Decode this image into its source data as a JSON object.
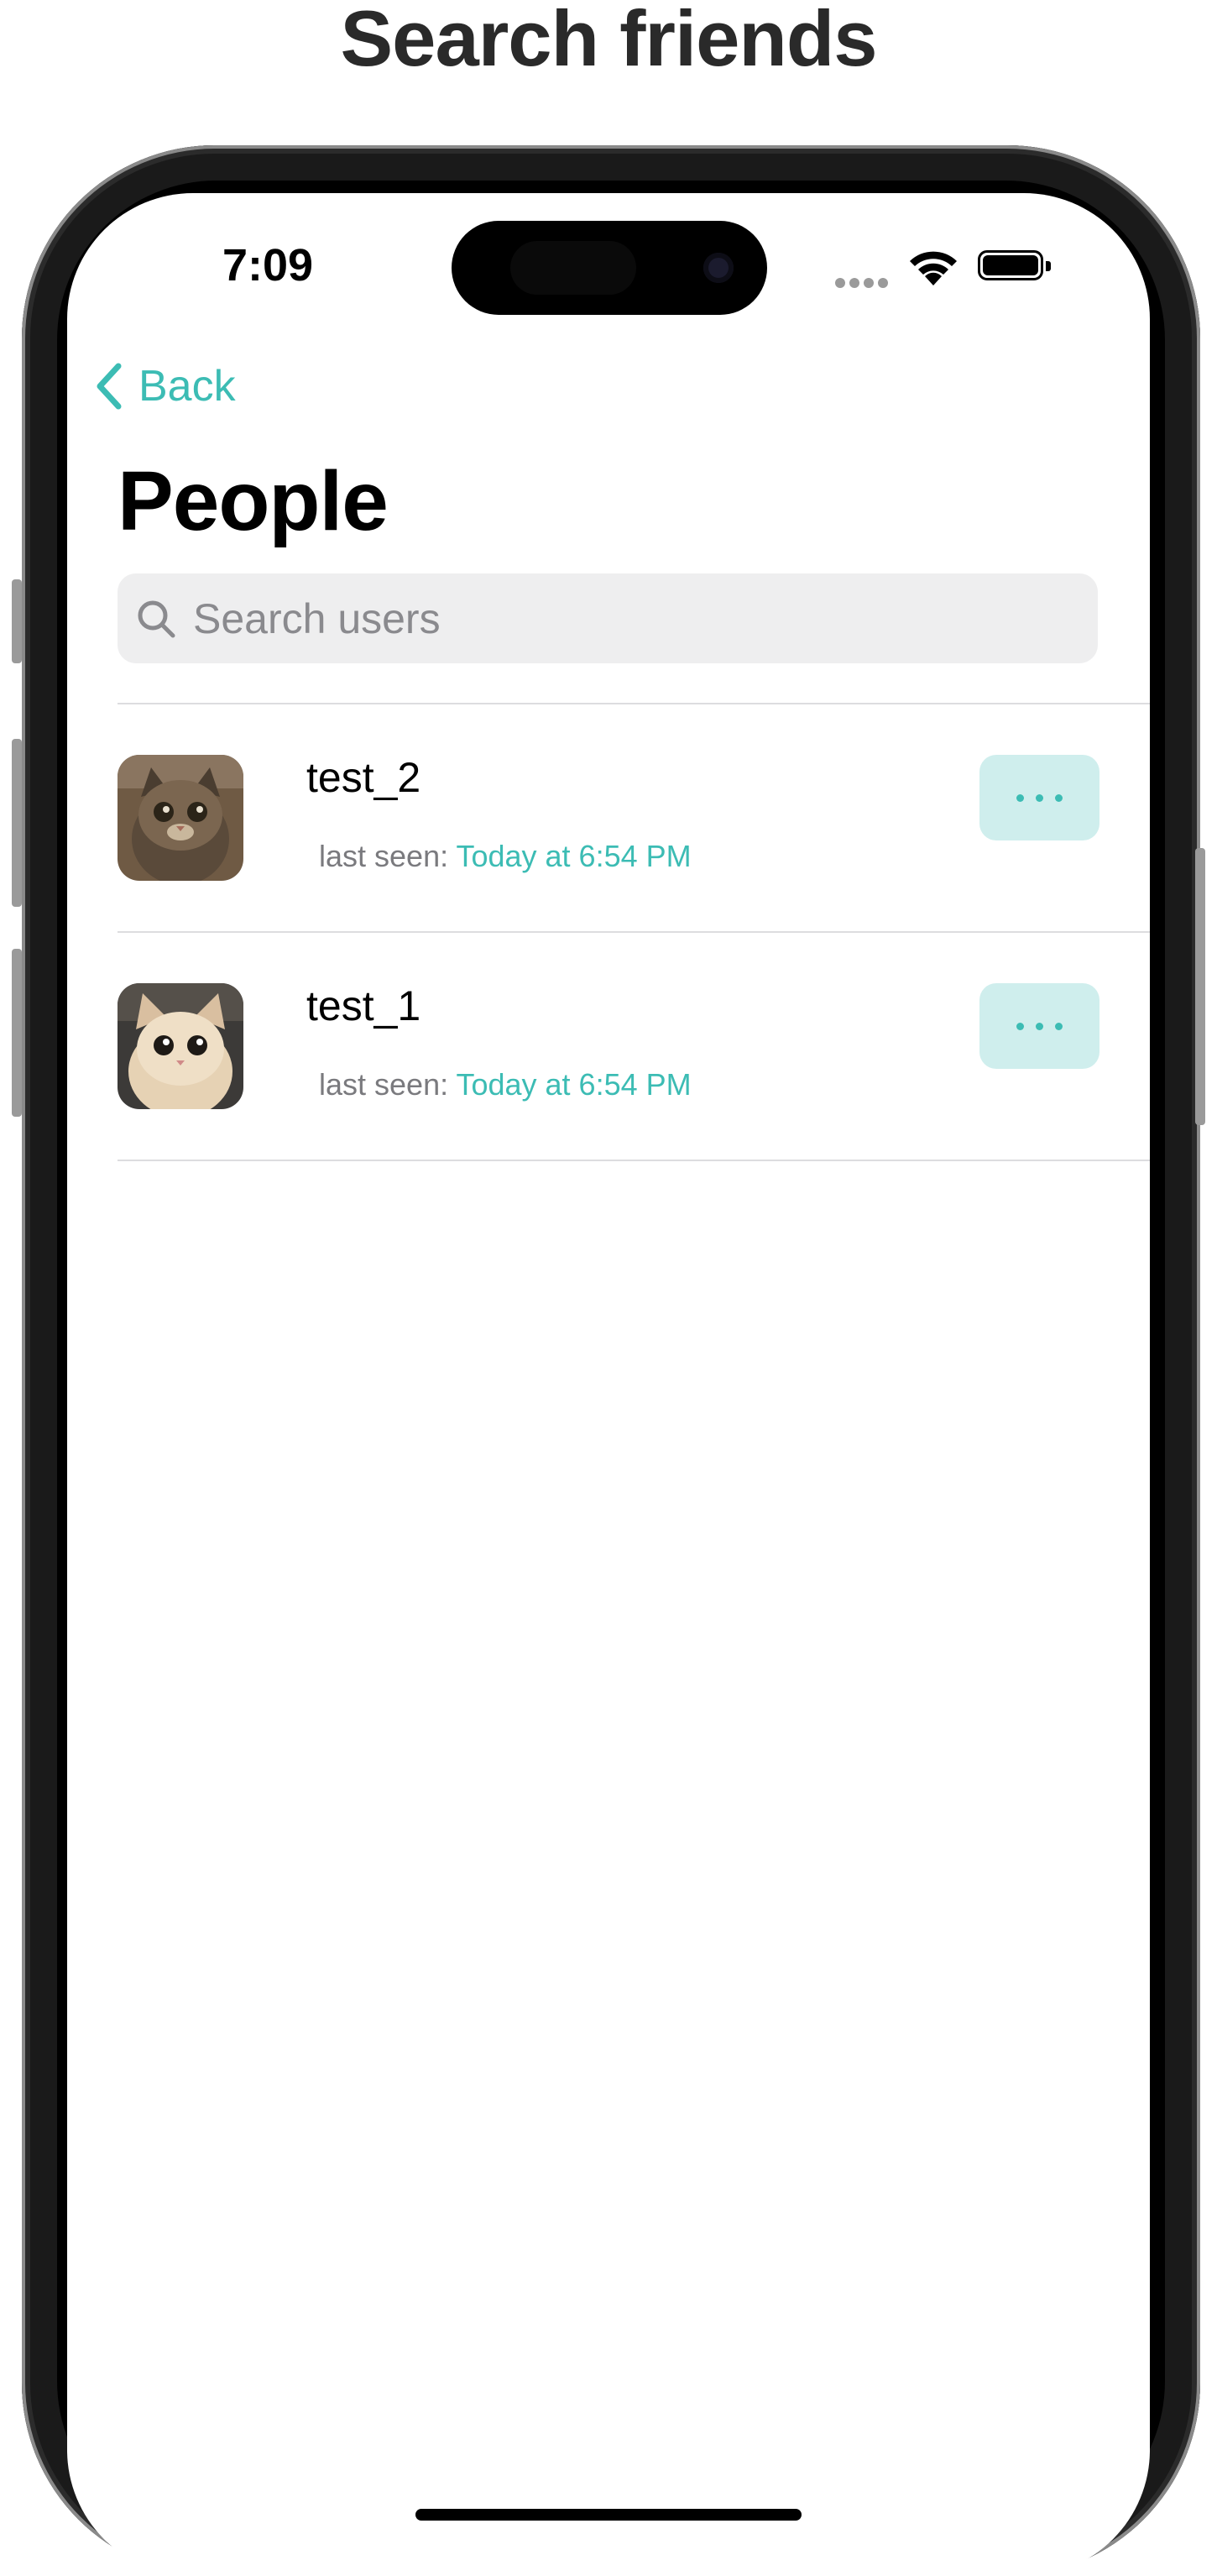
{
  "page_heading": "Search friends",
  "status_bar": {
    "time": "7:09",
    "icons": [
      "signal-icon",
      "wifi-icon",
      "battery-icon"
    ]
  },
  "nav": {
    "back_label": "Back",
    "title": "People"
  },
  "search": {
    "placeholder": "Search users",
    "value": ""
  },
  "users": [
    {
      "name": "test_2",
      "last_seen_label": "last seen:",
      "last_seen_time": "Today at 6:54 PM"
    },
    {
      "name": "test_1",
      "last_seen_label": "last seen:",
      "last_seen_time": "Today at 6:54 PM"
    }
  ],
  "colors": {
    "accent": "#3cbcb4",
    "accent_bg": "#cfeeed",
    "search_bg": "#eeeeef"
  }
}
